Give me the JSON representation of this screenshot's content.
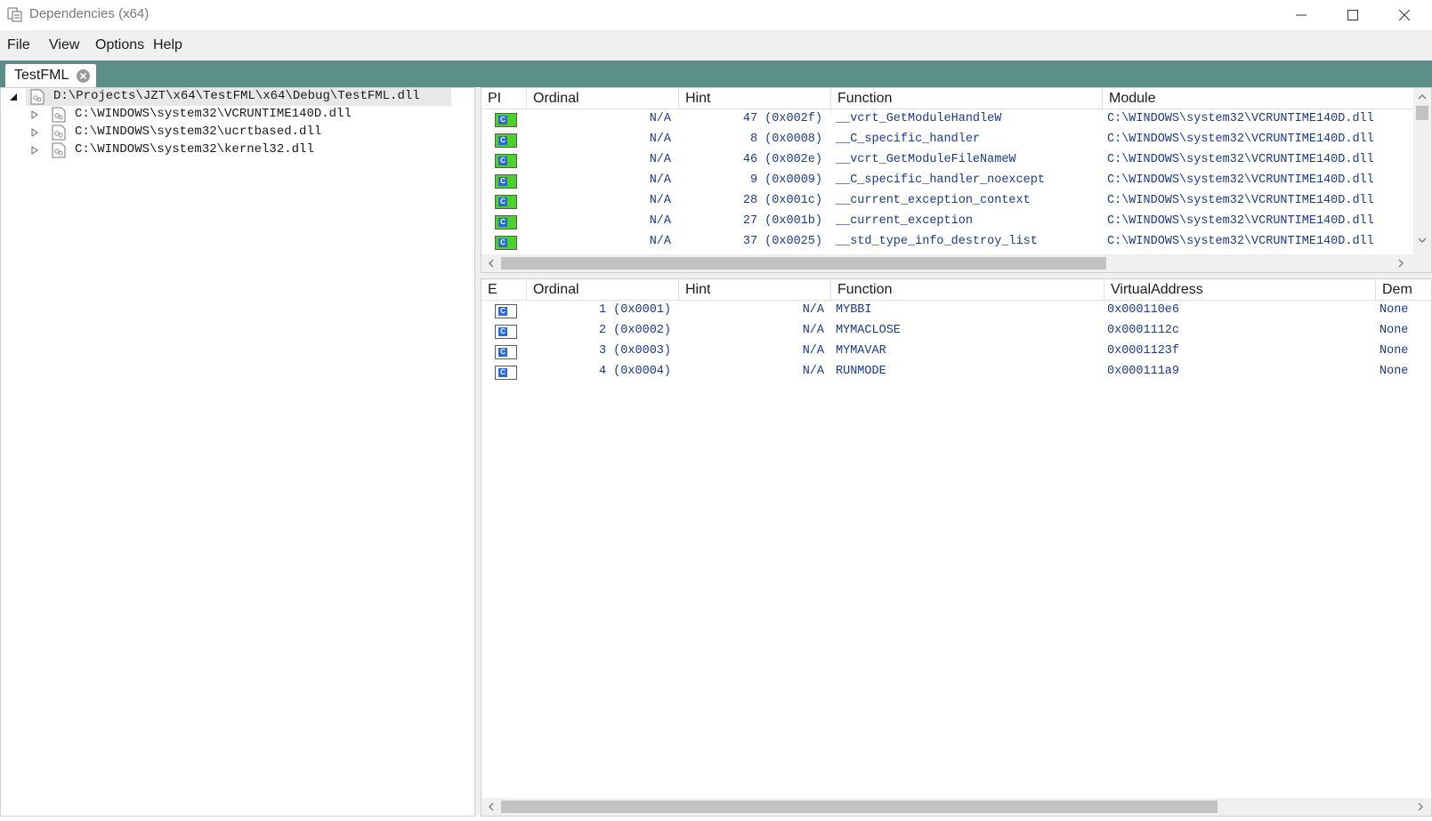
{
  "window": {
    "title": "Dependencies (x64)"
  },
  "menu": {
    "items": [
      "File",
      "View",
      "Options",
      "Help"
    ]
  },
  "tabs": [
    {
      "label": "TestFML"
    }
  ],
  "tree": {
    "root": "D:\\Projects\\JZT\\x64\\TestFML\\x64\\Debug\\TestFML.dll",
    "children": [
      "C:\\WINDOWS\\system32\\VCRUNTIME140D.dll",
      "C:\\WINDOWS\\system32\\ucrtbased.dll",
      "C:\\WINDOWS\\system32\\kernel32.dll"
    ]
  },
  "imports": {
    "columns": [
      "PI",
      "Ordinal",
      "Hint",
      "Function",
      "Module"
    ],
    "rows": [
      {
        "ordinal": "N/A",
        "hint": "47  (0x002f)",
        "function": "__vcrt_GetModuleHandleW",
        "module": "C:\\WINDOWS\\system32\\VCRUNTIME140D.dll"
      },
      {
        "ordinal": "N/A",
        "hint": "8  (0x0008)",
        "function": "__C_specific_handler",
        "module": "C:\\WINDOWS\\system32\\VCRUNTIME140D.dll"
      },
      {
        "ordinal": "N/A",
        "hint": "46  (0x002e)",
        "function": "__vcrt_GetModuleFileNameW",
        "module": "C:\\WINDOWS\\system32\\VCRUNTIME140D.dll"
      },
      {
        "ordinal": "N/A",
        "hint": "9  (0x0009)",
        "function": "__C_specific_handler_noexcept",
        "module": "C:\\WINDOWS\\system32\\VCRUNTIME140D.dll"
      },
      {
        "ordinal": "N/A",
        "hint": "28  (0x001c)",
        "function": "__current_exception_context",
        "module": "C:\\WINDOWS\\system32\\VCRUNTIME140D.dll"
      },
      {
        "ordinal": "N/A",
        "hint": "27  (0x001b)",
        "function": "__current_exception",
        "module": "C:\\WINDOWS\\system32\\VCRUNTIME140D.dll"
      },
      {
        "ordinal": "N/A",
        "hint": "37  (0x0025)",
        "function": "__std_type_info_destroy_list",
        "module": "C:\\WINDOWS\\system32\\VCRUNTIME140D.dll"
      }
    ]
  },
  "exports": {
    "columns": [
      "E",
      "Ordinal",
      "Hint",
      "Function",
      "VirtualAddress",
      "Dem"
    ],
    "rows": [
      {
        "ordinal": "1  (0x0001)",
        "hint": "N/A",
        "function": "MYBBI",
        "address": "0x000110e6",
        "dem": "None"
      },
      {
        "ordinal": "2  (0x0002)",
        "hint": "N/A",
        "function": "MYMACLOSE",
        "address": "0x0001112c",
        "dem": "None"
      },
      {
        "ordinal": "3  (0x0003)",
        "hint": "N/A",
        "function": "MYMAVAR",
        "address": "0x0001123f",
        "dem": "None"
      },
      {
        "ordinal": "4  (0x0004)",
        "hint": "N/A",
        "function": "RUNMODE",
        "address": "0x000111a9",
        "dem": "None"
      }
    ]
  },
  "icons": {
    "app": "dependencies-app-icon",
    "file": "dll-file-icon",
    "import": "imported-function-icon",
    "export": "exported-function-icon"
  },
  "colors": {
    "accent": "#5b8f87",
    "import_icon": "#4cd12b",
    "row_text": "#1a3a8a"
  }
}
